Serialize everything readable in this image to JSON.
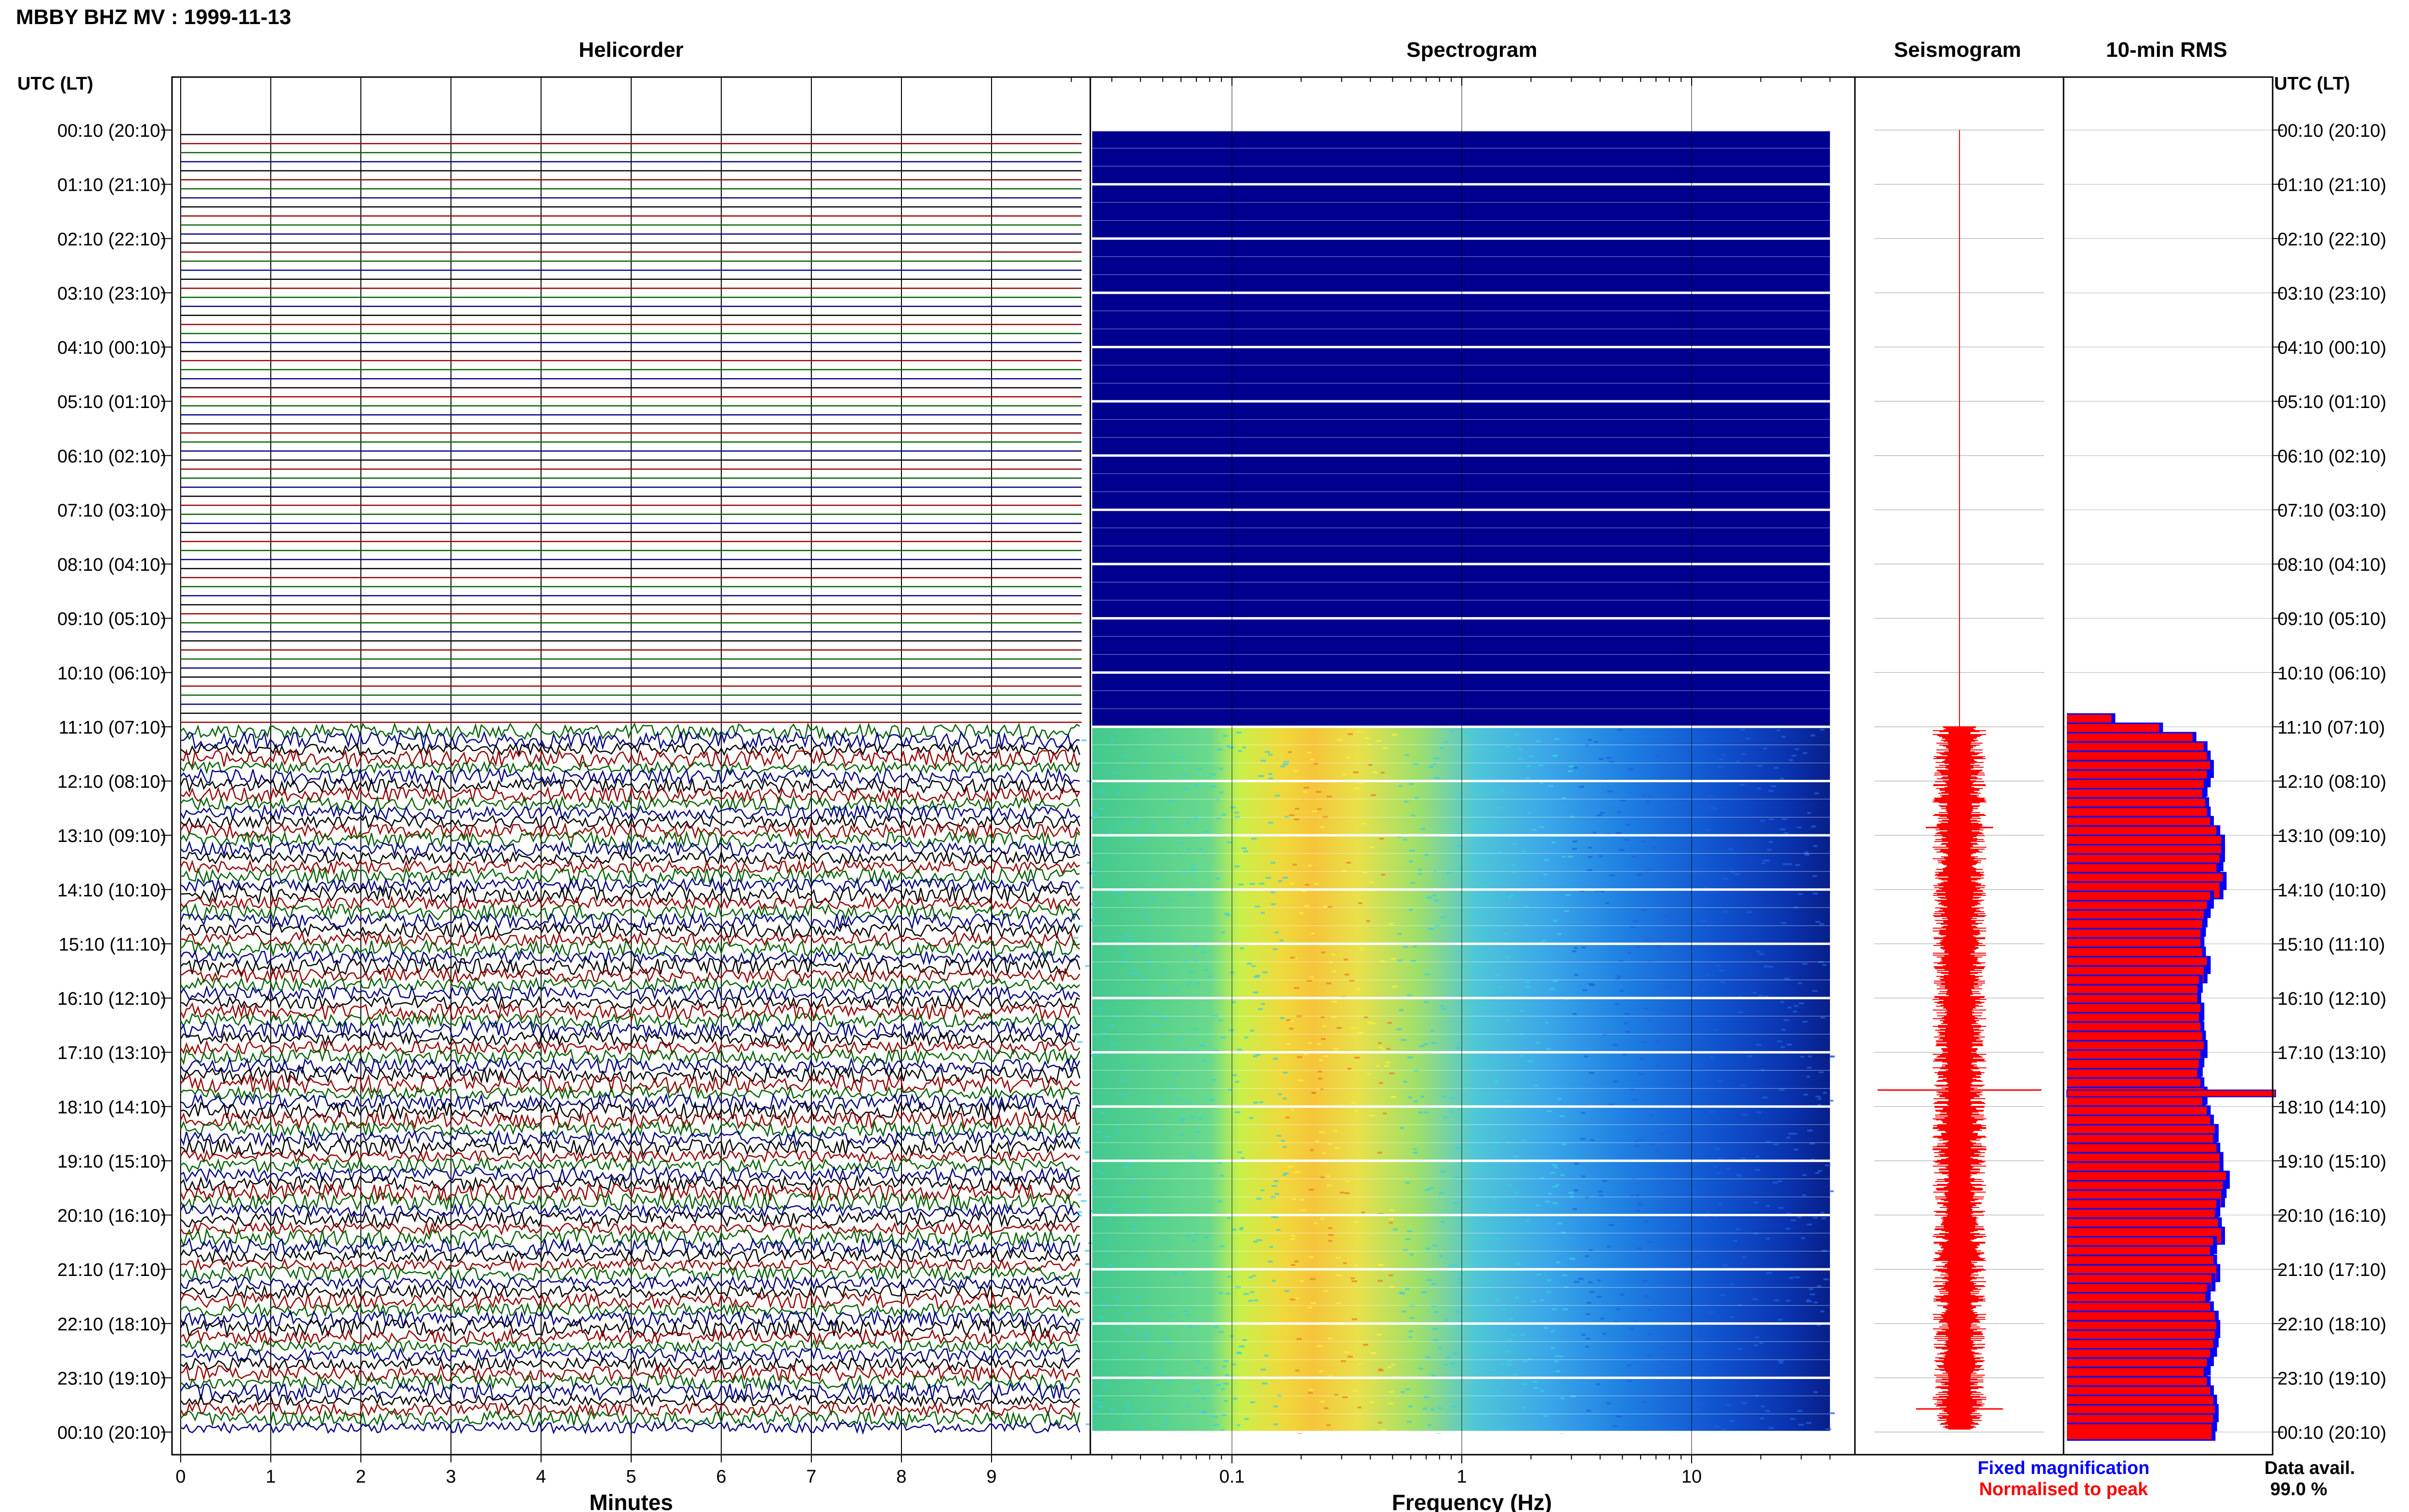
{
  "title": "MBBY BHZ MV : 1999-11-13",
  "panels": {
    "helicorder": "Helicorder",
    "spectrogram": "Spectrogram",
    "seismogram": "Seismogram",
    "rms": "10-min RMS"
  },
  "time_axis_label": "UTC (LT)",
  "time_labels": [
    "00:10 (20:10)",
    "01:10 (21:10)",
    "02:10 (22:10)",
    "03:10 (23:10)",
    "04:10 (00:10)",
    "05:10 (01:10)",
    "06:10 (02:10)",
    "07:10 (03:10)",
    "08:10 (04:10)",
    "09:10 (05:10)",
    "10:10 (06:10)",
    "11:10 (07:10)",
    "12:10 (08:10)",
    "13:10 (09:10)",
    "14:10 (10:10)",
    "15:10 (11:10)",
    "16:10 (12:10)",
    "17:10 (13:10)",
    "18:10 (14:10)",
    "19:10 (15:10)",
    "20:10 (16:10)",
    "21:10 (17:10)",
    "22:10 (18:10)",
    "23:10 (19:10)",
    "00:10 (20:10)"
  ],
  "helicorder_axis": {
    "label": "Minutes",
    "ticks": [
      "0",
      "1",
      "2",
      "3",
      "4",
      "5",
      "6",
      "7",
      "8",
      "9"
    ]
  },
  "spectrogram_axis": {
    "label": "Frequency (Hz)",
    "ticks": [
      "0.1",
      "1",
      "10"
    ]
  },
  "legend": {
    "fixed": "Fixed magnification",
    "normalised": "Normalised to peak"
  },
  "data_avail": {
    "label": "Data avail.",
    "value": "99.0 %"
  },
  "colors": {
    "trace_cycle": [
      "#000000",
      "#9b0000",
      "#006400",
      "#00008b"
    ],
    "spectrogram_empty": "#00008f",
    "rms_fixed": "#0000ff",
    "rms_normalised": "#ff0000",
    "seismogram": "#ff0000"
  },
  "chart_data": {
    "type": "bar",
    "title": "10-min RMS",
    "orientation": "horizontal",
    "units": "relative",
    "row_start": "11:10 UTC",
    "row_interval_minutes": 10,
    "values": [
      0.28,
      0.58,
      0.79,
      0.86,
      0.88,
      0.9,
      0.88,
      0.86,
      0.85,
      0.87,
      0.88,
      0.9,
      0.94,
      0.97,
      0.97,
      0.96,
      0.94,
      0.98,
      0.96,
      0.9,
      0.88,
      0.86,
      0.85,
      0.84,
      0.84,
      0.85,
      0.88,
      0.86,
      0.83,
      0.82,
      0.82,
      0.84,
      0.83,
      0.84,
      0.85,
      0.86,
      0.84,
      0.83,
      0.82,
      0.84,
      0.86,
      0.85,
      0.88,
      0.9,
      0.93,
      0.92,
      0.94,
      0.96,
      0.96,
      1.0,
      0.98,
      0.97,
      0.94,
      0.93,
      0.95,
      0.97,
      0.92,
      0.9,
      0.92,
      0.94,
      0.91,
      0.88,
      0.87,
      0.9,
      0.93,
      0.94,
      0.93,
      0.92,
      0.9,
      0.88,
      0.86,
      0.88,
      0.9,
      0.92,
      0.93,
      0.92,
      0.91
    ]
  }
}
